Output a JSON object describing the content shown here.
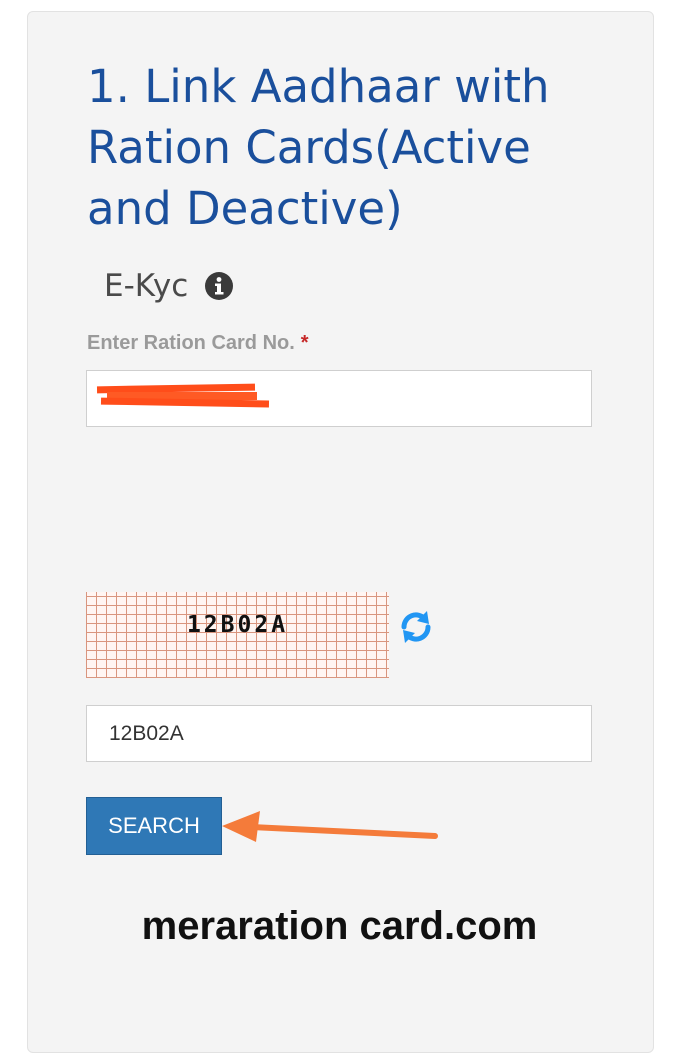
{
  "heading": {
    "title": "1. Link Aadhaar with Ration Cards(Active and Deactive)"
  },
  "ekyc": {
    "label": "E-Kyc",
    "icon": "info-circle-icon"
  },
  "ration_field": {
    "label": "Enter Ration Card No.",
    "required_mark": "*",
    "value_redacted": true
  },
  "captcha": {
    "image_text": "12B02A",
    "refresh_icon": "refresh-icon",
    "input_value": "12B02A"
  },
  "search_button": {
    "label": "SEARCH"
  },
  "annotation": {
    "arrow_color": "#f47b3a"
  },
  "watermark": {
    "text": "meraration card.com"
  },
  "colors": {
    "title": "#1a4f9c",
    "button": "#2f78b6",
    "required": "#c62828",
    "arrow": "#f47b3a",
    "redaction": "#ff4d1a"
  }
}
